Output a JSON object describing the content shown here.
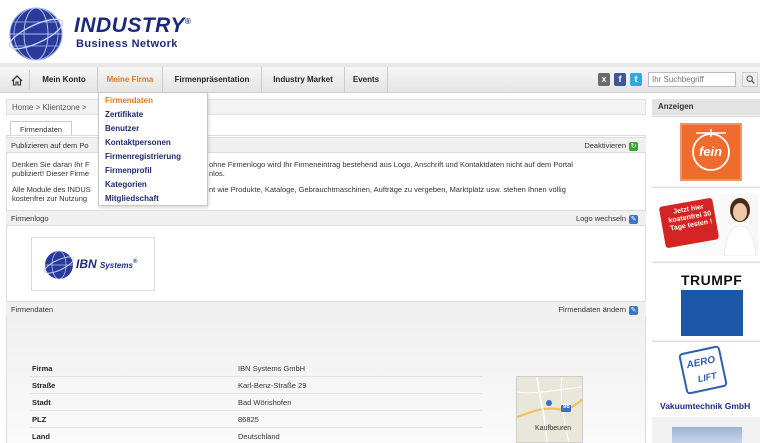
{
  "header": {
    "brand": "INDUSTRY",
    "brand_reg": "®",
    "brand_sub": "Business Network"
  },
  "nav": {
    "items": [
      {
        "label": "Mein Konto"
      },
      {
        "label": "Meine Firma",
        "active": true
      },
      {
        "label": "Firmenpräsentation"
      },
      {
        "label": "Industry Market"
      },
      {
        "label": "Events"
      }
    ],
    "search_placeholder": "Ihr Suchbegriff",
    "social": [
      "xing",
      "facebook",
      "twitter"
    ]
  },
  "breadcrumb": "Home > Klientzone >",
  "dropdown": {
    "items": [
      {
        "label": "Firmendaten",
        "active": true
      },
      {
        "label": "Zertifikate"
      },
      {
        "label": "Benutzer"
      },
      {
        "label": "Kontaktpersonen"
      },
      {
        "label": "Firmenregistrierung"
      },
      {
        "label": "Firmenprofil"
      },
      {
        "label": "Kategorien"
      },
      {
        "label": "Mitgliedschaft"
      }
    ]
  },
  "tab": {
    "label": "Firmendaten"
  },
  "publish": {
    "label": "Publizieren auf dem Po",
    "action": "Deaktivieren"
  },
  "info": {
    "line1a": "Denken Sie daran Ihr F",
    "line1b": "ohne Firmenlogo wird Ihr Firmeneintrag bestehend aus Logo, Anschrift und Kontaktdaten nicht auf dem Portal",
    "line2a": "publiziert! Dieser Firme",
    "line2b": "nlos.",
    "line3a": "Alle Module des INDUS",
    "line3b": "nt wie Produkte, Kataloge, Gebrauchtmaschinen, Aufträge zu vergeben, Marktplatz usw. stehen Ihnen völlig",
    "line4a": "kostenfrei zur Nutzung"
  },
  "logo_section": {
    "title": "Firmenlogo",
    "action": "Logo wechseln",
    "logo_name": "IBN",
    "logo_sub": "Systems",
    "logo_reg": "®"
  },
  "data_section": {
    "title": "Firmendaten",
    "action": "Firmendaten ändern",
    "rows": [
      {
        "label": "Firma",
        "value": "IBN Systems GmbH"
      },
      {
        "label": "Straße",
        "value": "Karl-Benz-Straße 29"
      },
      {
        "label": "Stadt",
        "value": "Bad Wörishofen"
      },
      {
        "label": "PLZ",
        "value": "86825"
      },
      {
        "label": "Land",
        "value": "Deutschland"
      }
    ],
    "map_label": "Kaufbeuren",
    "map_road": "96"
  },
  "sidebar": {
    "title": "Anzeigen",
    "ads": [
      {
        "name": "fein-ad",
        "text": "fein"
      },
      {
        "name": "kostenfrei-ad",
        "text": "Jetzt hier kostenfrei 30 Tage testen !"
      },
      {
        "name": "trumpf-ad",
        "text": "TRUMPF"
      },
      {
        "name": "aerolift-ad",
        "text_top": "AERO",
        "text_mid": "LIFT",
        "caption": "Vakuumtechnik GmbH"
      }
    ]
  },
  "colors": {
    "brand_blue": "#1d2a7a",
    "accent_orange": "#e07a1a",
    "trumpf_blue": "#1c57a8"
  }
}
